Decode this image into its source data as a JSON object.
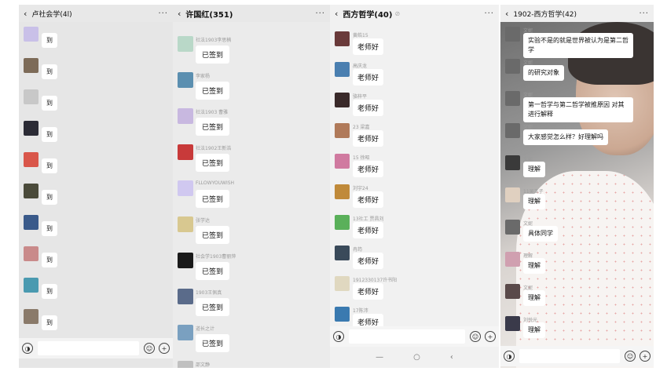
{
  "panels": [
    {
      "title": "卢社会学(4l)",
      "back_icon": "chevron-left-icon",
      "more_icon": "more-icon",
      "avatar_colors": [
        "#c9c0e8",
        "#7d6b58",
        "#c8c8c8",
        "#2b2b35",
        "#d9564a",
        "#4a4a3a",
        "#3a5a8a",
        "#c98a8a",
        "#4a9ab0",
        "#8a7a6a"
      ],
      "messages": [
        {
          "nick": "",
          "text": "到"
        },
        {
          "nick": "",
          "text": "到"
        },
        {
          "nick": "",
          "text": "到"
        },
        {
          "nick": "",
          "text": "到"
        },
        {
          "nick": "",
          "text": "到"
        },
        {
          "nick": "",
          "text": "到"
        },
        {
          "nick": "",
          "text": "到"
        },
        {
          "nick": "",
          "text": "到"
        },
        {
          "nick": "",
          "text": "到"
        },
        {
          "nick": "",
          "text": "到"
        }
      ],
      "voice_icon": "voice-icon",
      "emoji_icon": "emoji-icon",
      "plus_icon": "plus-icon"
    },
    {
      "title": "许国红(351)",
      "back_icon": "chevron-left-icon",
      "more_icon": "more-icon",
      "avatar_colors": [
        "#b9d8c8",
        "#5b8fb0",
        "#c8b8e0",
        "#c83a3a",
        "#d0c8f0",
        "#d8c890",
        "#1a1a1a",
        "#5a6b8a",
        "#7aa0c0",
        "#c0c0c0"
      ],
      "messages": [
        {
          "nick": "社法1903李思楠",
          "text": "已签到"
        },
        {
          "nick": "李家杨",
          "text": "已签到"
        },
        {
          "nick": "社法1903 曹雅",
          "text": "已签到"
        },
        {
          "nick": "社法1902王新浩",
          "text": "已签到"
        },
        {
          "nick": "FLLOWYOUWISH",
          "text": "已签到"
        },
        {
          "nick": "张学达",
          "text": "已签到"
        },
        {
          "nick": "社会学1903曹丽萍",
          "text": "已签到"
        },
        {
          "nick": "1903王佩真",
          "text": "已签到"
        },
        {
          "nick": "道长之计",
          "text": "已签到"
        },
        {
          "nick": "邵文静",
          "text": ""
        }
      ]
    },
    {
      "title": "西方哲学(40)",
      "back_icon": "chevron-left-icon",
      "more_icon": "more-icon",
      "muted_icon": "mute-icon",
      "avatar_colors": [
        "#6a3a3a",
        "#4a7fb0",
        "#3a2a2a",
        "#b07a5a",
        "#d07aa0",
        "#c08a3a",
        "#5ab05a",
        "#3a4a5a",
        "#e0d8c0",
        "#3a7ab0"
      ],
      "messages": [
        {
          "nick": "黄皓15",
          "text": "老师好"
        },
        {
          "nick": "高庆龙",
          "text": "老师好"
        },
        {
          "nick": "骆梓平",
          "text": "老师好"
        },
        {
          "nick": "23 梁嘉",
          "text": "老师好"
        },
        {
          "nick": "15 徐昭",
          "text": "老师好"
        },
        {
          "nick": "刘宇24",
          "text": "老师好"
        },
        {
          "nick": "13社工 贾昌刘",
          "text": "老师好"
        },
        {
          "nick": "冉筠",
          "text": "老师好"
        },
        {
          "nick": "1912330137许书阳",
          "text": "老师好"
        },
        {
          "nick": "17陈沛",
          "text": "老师好"
        }
      ],
      "voice_icon": "voice-icon",
      "emoji_icon": "emoji-icon",
      "plus_icon": "plus-icon",
      "nav": [
        "—",
        "○",
        "‹"
      ]
    },
    {
      "title": "1902-西方哲学(42)",
      "back_icon": "chevron-left-icon",
      "more_icon": "more-icon",
      "avatar_colors": [
        "#6a6a6a",
        "#6a6a6a",
        "#6a6a6a",
        "#6a6a6a",
        "#3a3a3a",
        "#e0d0c0",
        "#6a6a6a",
        "#d0a0b0",
        "#5a4a4a",
        "#3a3a4a"
      ],
      "messages": [
        {
          "nick": "文妮",
          "text": "实验不是的就是世界被认为是第二哲学"
        },
        {
          "nick": "文妮",
          "text": "的研究对象"
        },
        {
          "nick": "文妮",
          "text": "第一哲学与第二哲学被推原因 对其进行解释"
        },
        {
          "nick": "文妮",
          "text": "大家感觉怎么样？好理解吗"
        },
        {
          "nick": "文妮",
          "text": "理解"
        },
        {
          "nick": "11吴玉子",
          "text": "理解"
        },
        {
          "nick": "文妮",
          "text": "具体同学"
        },
        {
          "nick": "理解",
          "text": "理解"
        },
        {
          "nick": "文妮",
          "text": "理解"
        },
        {
          "nick": "刘悦光",
          "text": "理解"
        }
      ],
      "voice_icon": "voice-icon",
      "emoji_icon": "emoji-icon",
      "plus_icon": "plus-icon"
    }
  ]
}
